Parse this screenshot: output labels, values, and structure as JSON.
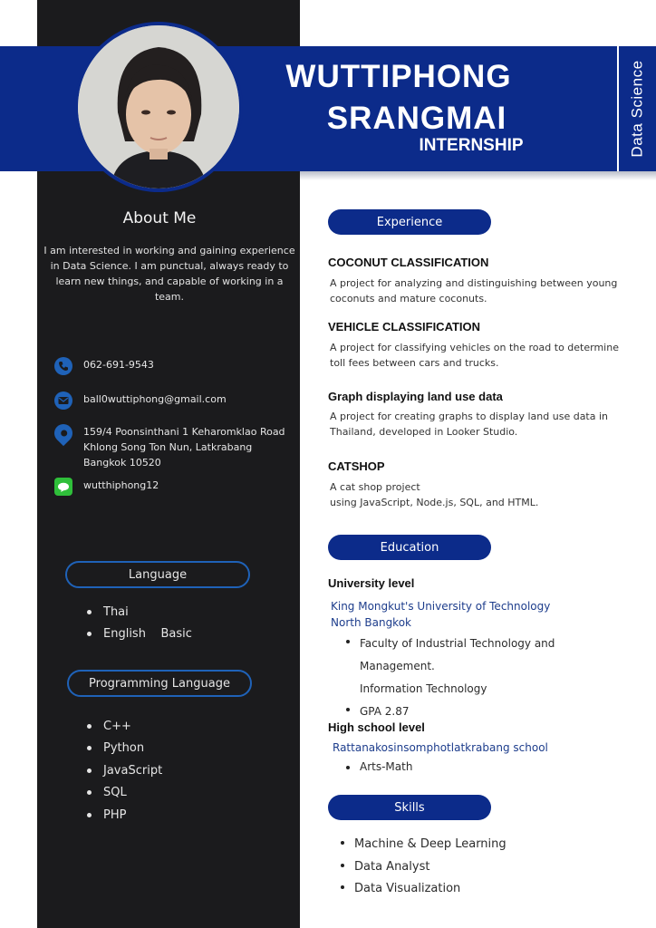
{
  "header": {
    "name_line1": "WUTTIPHONG",
    "name_line2": "SRANGMAI",
    "subtitle": "INTERNSHIP",
    "side_label": "Data Science"
  },
  "about": {
    "title": "About Me",
    "text": "I am interested in working and gaining experience in Data Science. I am punctual, always ready to learn new things, and capable of working in a team."
  },
  "contact": {
    "phone": "062-691-9543",
    "email": "ball0wuttiphong@gmail.com",
    "address": "159/4 Poonsinthani 1 Keharomklao Road Khlong Song Ton Nun, Latkrabang Bangkok 10520",
    "line_id": "wutthiphong12",
    "icons": [
      "phone-icon",
      "email-icon",
      "location-pin-icon",
      "line-app-icon"
    ]
  },
  "language": {
    "title": "Language",
    "items": [
      "Thai",
      "English    Basic"
    ]
  },
  "programming": {
    "title": "Programming Language",
    "items": [
      "C++",
      "Python",
      "JavaScript",
      "SQL",
      "PHP"
    ]
  },
  "experience": {
    "title": "Experience",
    "items": [
      {
        "heading": "COCONUT CLASSIFICATION",
        "desc": "A project for analyzing and distinguishing between young coconuts and mature coconuts."
      },
      {
        "heading": "VEHICLE CLASSIFICATION",
        "desc": "A project for classifying vehicles on the road to determine toll fees between cars and trucks."
      },
      {
        "heading": "Graph displaying land use data",
        "desc": "A project for creating graphs to display land use data in Thailand, developed in Looker Studio."
      },
      {
        "heading": "CATSHOP",
        "desc_line1": "A cat shop project",
        "desc_line2": "using JavaScript, Node.js, SQL, and HTML."
      }
    ]
  },
  "education": {
    "title": "Education",
    "university_heading": "University level",
    "university_name_line1": "King Mongkut's University of Technology",
    "university_name_line2": "North Bangkok",
    "faculty_line1": "Faculty of Industrial Technology and",
    "faculty_line2": "Management.",
    "faculty_line3": "Information Technology",
    "gpa": "GPA 2.87",
    "highschool_heading": "High school level",
    "highschool_name": "Rattanakosinsomphotlatkrabang school",
    "highschool_program": "Arts-Math"
  },
  "skills": {
    "title": "Skills",
    "items": [
      "Machine & Deep Learning",
      "Data Analyst",
      "Data Visualization"
    ]
  },
  "colors": {
    "navy": "#0c2b8a",
    "dark_column": "#1b1b1d",
    "accent_blue": "#1f62b8",
    "line_green": "#2fbf3a"
  }
}
